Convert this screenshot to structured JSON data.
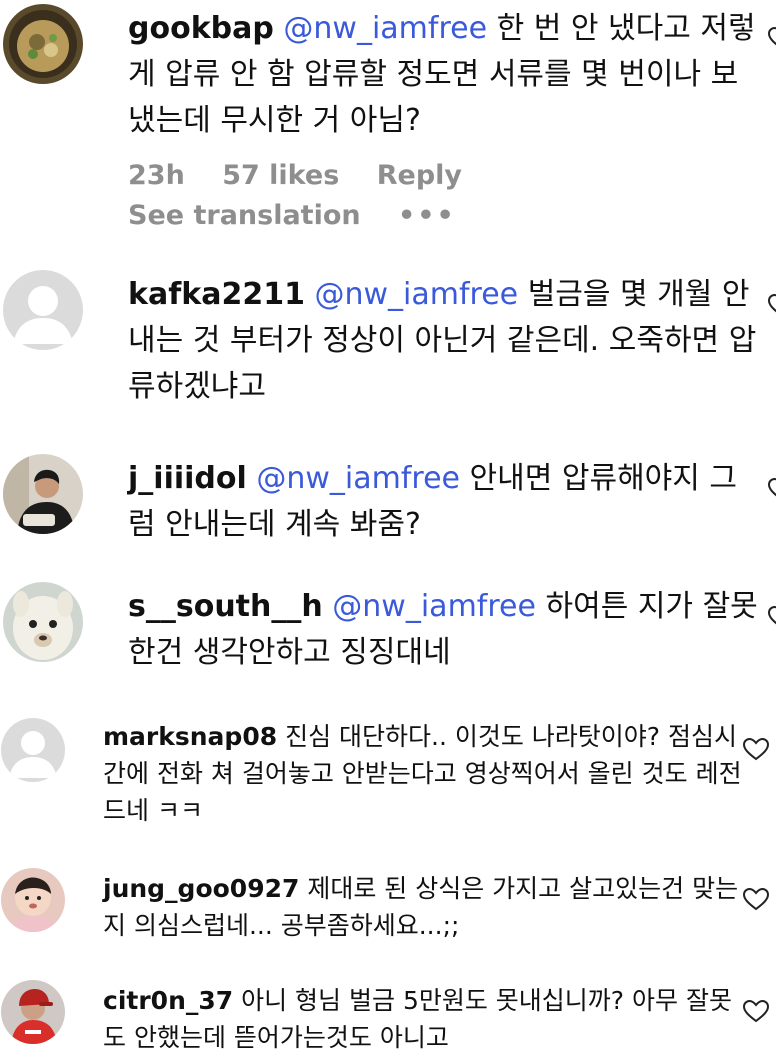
{
  "comments": [
    {
      "username": "gookbap",
      "mention": "@nw_iamfree",
      "text": "한 번 안 냈다고 저렇게 압류 안 함 압류할 정도면 서류를 몇 번이나 보냈는데 무시한 거 아님?",
      "time": "23h",
      "likes": "57 likes",
      "reply": "Reply",
      "translate": "See translation",
      "more": "•••"
    },
    {
      "username": "kafka2211",
      "mention": "@nw_iamfree",
      "text": "벌금을 몇 개월 안 내는 것 부터가 정상이 아닌거 같은데. 오죽하면 압류하겠냐고"
    },
    {
      "username": "j_iiiidol",
      "mention": "@nw_iamfree",
      "text": "안내면 압류해야지 그럼 안내는데 계속 봐줌?"
    },
    {
      "username": "s__south__h",
      "mention": "@nw_iamfree",
      "text": "하여튼 지가 잘못한건 생각안하고 징징대네"
    },
    {
      "username": "marksnap08",
      "text": "진심 대단하다.. 이것도 나라탓이야? 점심시간에 전화 쳐 걸어놓고 안받는다고 영상찍어서 올린 것도 레전드네 ㅋㅋ"
    },
    {
      "username": "jung_goo0927",
      "text": "제대로 된 상식은 가지고 살고있는건 맞는지 의심스럽네... 공부좀하세요...;;"
    },
    {
      "username": "citr0n_37",
      "text": "아니 형님 벌금 5만원도 못내십니까? 아무 잘못도 안했는데 뜯어가는것도 아니고"
    }
  ],
  "icons": {
    "like": "heart-outline-icon",
    "more": "ellipsis-icon"
  },
  "colors": {
    "mention": "#3a5ad9",
    "meta": "#8e8e8e",
    "text": "#111111"
  }
}
